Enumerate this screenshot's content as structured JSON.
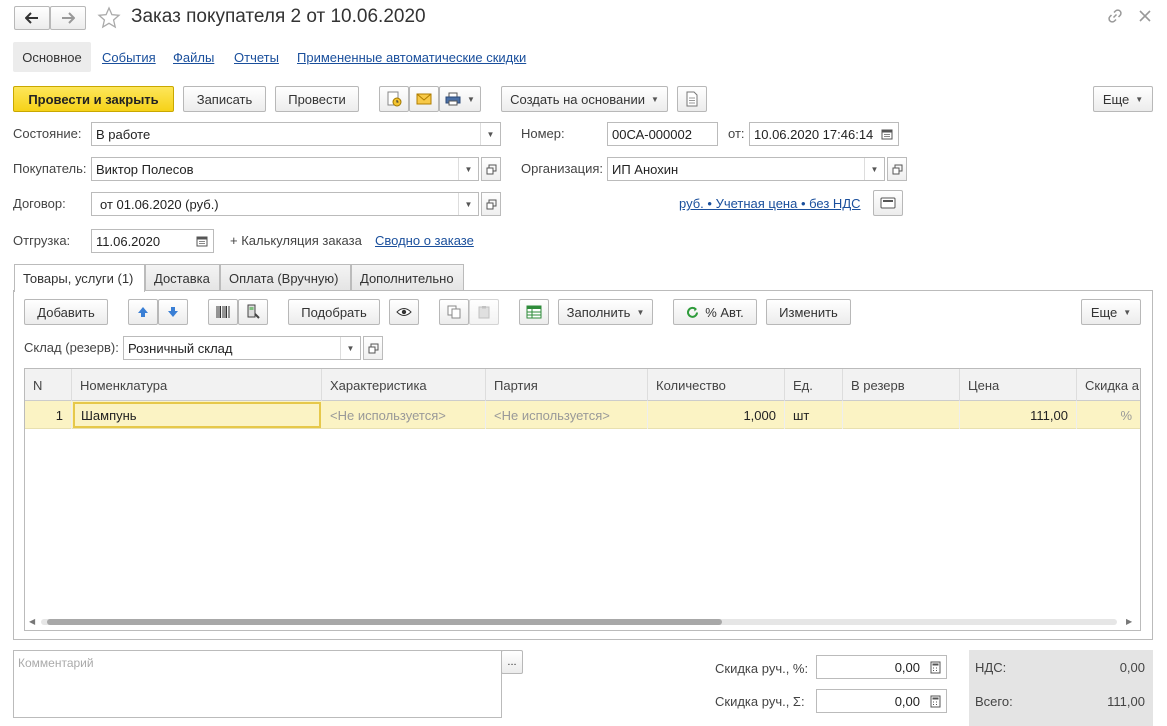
{
  "window": {
    "title": "Заказ покупателя 2 от 10.06.2020"
  },
  "nav_tabs": [
    "Основное",
    "События",
    "Файлы",
    "Отчеты",
    "Примененные автоматические скидки"
  ],
  "toolbar": {
    "post_close": "Провести и закрыть",
    "save": "Записать",
    "post": "Провести",
    "create_based": "Создать на основании",
    "more": "Еще"
  },
  "header": {
    "state_label": "Состояние:",
    "state_value": "В работе",
    "number_label": "Номер:",
    "number_value": "00СА-000002",
    "date_from_label": "от:",
    "date_value": "10.06.2020 17:46:14",
    "buyer_label": "Покупатель:",
    "buyer_value": "Виктор Полесов",
    "org_label": "Организация:",
    "org_value": "ИП Анохин",
    "contract_label": "Договор:",
    "contract_value": "от 01.06.2020 (руб.)",
    "price_link": "руб. • Учетная цена • без НДС",
    "shipment_label": "Отгрузка:",
    "shipment_value": "11.06.2020",
    "calc_label": "+ Калькуляция заказа",
    "summary_link": "Сводно о заказе"
  },
  "tabs": [
    "Товары, услуги (1)",
    "Доставка",
    "Оплата (Вручную)",
    "Дополнительно"
  ],
  "table_toolbar": {
    "add": "Добавить",
    "pick": "Подобрать",
    "fill": "Заполнить",
    "auto_percent": "% Авт.",
    "change": "Изменить",
    "more": "Еще"
  },
  "warehouse": {
    "label": "Склад (резерв):",
    "value": "Розничный склад"
  },
  "table": {
    "columns": [
      "N",
      "Номенклатура",
      "Характеристика",
      "Партия",
      "Количество",
      "Ед.",
      "В резерв",
      "Цена",
      "Скидка а"
    ],
    "rows": [
      {
        "n": "1",
        "item": "Шампунь",
        "characteristic": "<Не используется>",
        "batch": "<Не используется>",
        "qty": "1,000",
        "unit": "шт",
        "reserve": "",
        "price": "111,00",
        "discount": "%"
      }
    ]
  },
  "footer": {
    "comment_placeholder": "Комментарий",
    "comment_button": "...",
    "discount_pct_label": "Скидка руч., %:",
    "discount_pct_value": "0,00",
    "discount_sum_label": "Скидка руч., Σ:",
    "discount_sum_value": "0,00",
    "vat_label": "НДС:",
    "vat_value": "0,00",
    "total_label": "Всего:",
    "total_value": "111,00"
  },
  "colors": {
    "primary_button": "#f6d218",
    "link": "#1a4f9c",
    "selected_row": "#fbf3c4",
    "active_cell_border": "#e6c84a",
    "totals_panel": "#e4e4e4"
  }
}
